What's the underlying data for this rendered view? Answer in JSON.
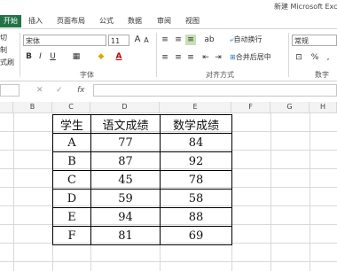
{
  "window": {
    "title": "新建 Microsoft Exce"
  },
  "tabs": [
    "开始",
    "插入",
    "页面布局",
    "公式",
    "数据",
    "审阅",
    "视图"
  ],
  "ribbon": {
    "clipboard": {
      "cut": "切",
      "copy": "制",
      "painter": "式刷"
    },
    "font": {
      "name": "宋体",
      "size": "11",
      "bold": "B",
      "italic": "I",
      "underline": "U",
      "group_label": "字体"
    },
    "alignment": {
      "wrap": "自动换行",
      "merge": "合并后居中",
      "group_label": "对齐方式"
    },
    "number": {
      "format": "常规",
      "group_label": "数字",
      "percent": "%",
      "comma": ","
    }
  },
  "formula_bar": {
    "fx": "fx"
  },
  "columns": [
    "B",
    "C",
    "D",
    "E",
    "F",
    "G",
    "H"
  ],
  "table": {
    "headers": [
      "学生",
      "语文成绩",
      "数学成绩"
    ],
    "rows": [
      [
        "A",
        "77",
        "84"
      ],
      [
        "B",
        "87",
        "92"
      ],
      [
        "C",
        "45",
        "78"
      ],
      [
        "D",
        "59",
        "58"
      ],
      [
        "E",
        "94",
        "88"
      ],
      [
        "F",
        "81",
        "69"
      ]
    ]
  }
}
